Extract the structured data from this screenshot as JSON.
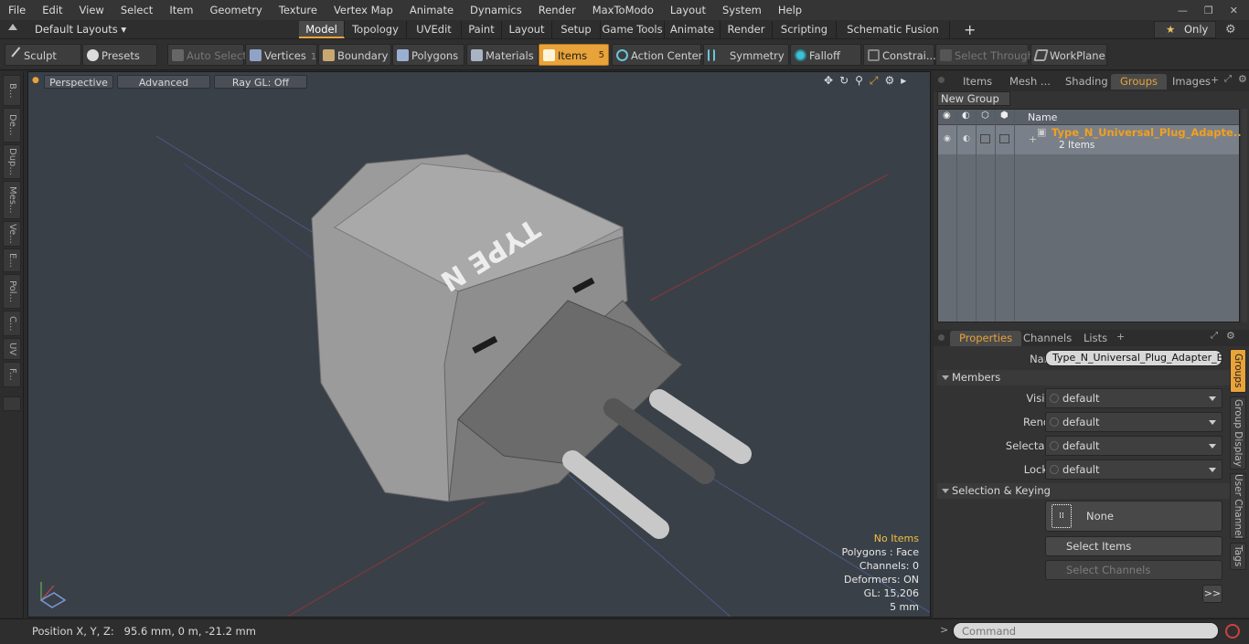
{
  "menu": [
    "File",
    "Edit",
    "View",
    "Select",
    "Item",
    "Geometry",
    "Texture",
    "Vertex Map",
    "Animate",
    "Dynamics",
    "Render",
    "MaxToModo",
    "Layout",
    "System",
    "Help"
  ],
  "layout_dropdown": "Default Layouts",
  "mode_tabs": [
    "Model",
    "Topology",
    "UVEdit",
    "Paint",
    "Layout",
    "Setup",
    "Game Tools",
    "Animate",
    "Render",
    "Scripting",
    "Schematic Fusion"
  ],
  "active_mode_tab": "Model",
  "add_tab_glyph": "+",
  "only_label": "Only",
  "toolbar": {
    "sculpt": "Sculpt",
    "presets": "Presets",
    "auto_select": "Auto Select",
    "vertices": "Vertices",
    "vertices_count": "1",
    "boundary": "Boundary",
    "polygons": "Polygons",
    "materials": "Materials",
    "items": "Items",
    "items_count": "5",
    "action_center": "Action Center",
    "symmetry": "Symmetry",
    "falloff": "Falloff",
    "constraints": "Constrai...",
    "select_through": "Select Through",
    "workplane": "WorkPlane"
  },
  "left_tabs": [
    "B...",
    "De...",
    "Dup...",
    "Mes...",
    "Ve...",
    "E...",
    "Pol...",
    "C...",
    "UV",
    "F..."
  ],
  "viewport": {
    "view": "Perspective",
    "shading": "Advanced",
    "raygl": "Ray GL: Off",
    "model_label": "TYPE N",
    "info": {
      "items": "No Items",
      "polygons": "Polygons : Face",
      "channels": "Channels: 0",
      "deformers": "Deformers: ON",
      "gl": "GL: 15,206",
      "unit": "5 mm"
    }
  },
  "status": {
    "position": "Position X, Y, Z:   95.6 mm, 0 m, -21.2 mm",
    "command_placeholder": "Command",
    "prompt": ">"
  },
  "top_panel": {
    "tabs": [
      "Items",
      "Mesh ...",
      "Shading",
      "Groups",
      "Images"
    ],
    "active_tab": "Groups",
    "new_group": "New Group",
    "name_header": "Name",
    "group_name": "Type_N_Universal_Plug_Adapte...",
    "group_count": "2 Items"
  },
  "bottom_panel": {
    "tabs": [
      "Properties",
      "Channels",
      "Lists"
    ],
    "active_tab": "Properties",
    "name_label": "Name",
    "name_value": "Type_N_Universal_Plug_Adapter_Blac",
    "members_section": "Members",
    "rows": [
      {
        "label": "Visible",
        "value": "default"
      },
      {
        "label": "Render",
        "value": "default"
      },
      {
        "label": "Selectable",
        "value": "default"
      },
      {
        "label": "Locked",
        "value": "default"
      }
    ],
    "selection_section": "Selection & Keying",
    "none_label": "None",
    "select_items": "Select Items",
    "select_channels": "Select Channels",
    "more": ">>",
    "side_tabs": [
      "Groups",
      "Group Display",
      "User Channels",
      "Tags"
    ]
  },
  "colors": {
    "accent": "#e8a33a",
    "viewport_bg": "#3a4048",
    "list_bg": "#666c73"
  }
}
